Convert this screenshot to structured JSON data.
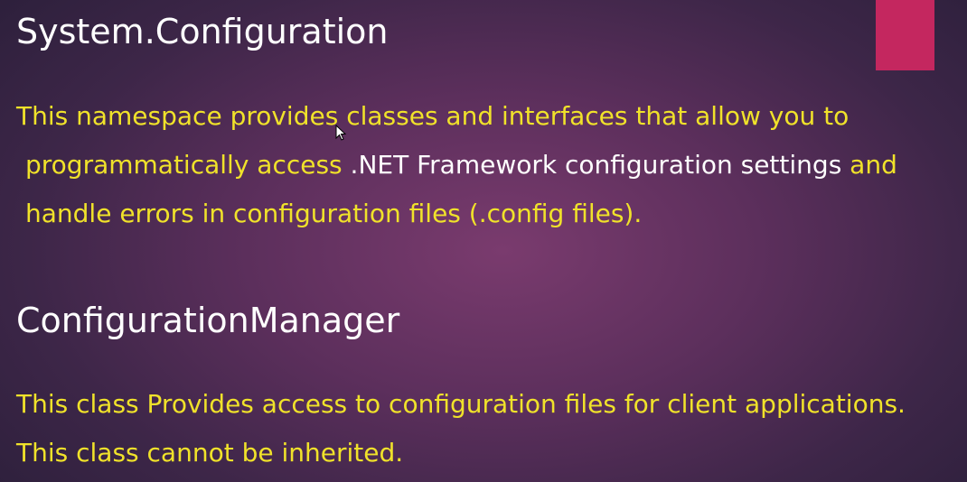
{
  "slide": {
    "heading1": "System.Configuration",
    "paragraph1": {
      "line1": "This namespace provides classes and interfaces that allow you to",
      "line2_a": "programmatically access ",
      "line2_b": ".NET Framework configuration settings",
      "line2_c": " and",
      "line3": "handle errors in configuration files (.config files)."
    },
    "heading2": "ConfigurationManager",
    "paragraph2": {
      "line1": "This class Provides access to configuration files for client applications.",
      "line2": "This class cannot be inherited."
    }
  },
  "colors": {
    "heading_text": "#ffffff",
    "body_text": "#f0e22a",
    "highlight_text": "#ffffff",
    "accent_block": "#c4275f"
  },
  "icons": {
    "pointer": "mouse-pointer-icon"
  }
}
